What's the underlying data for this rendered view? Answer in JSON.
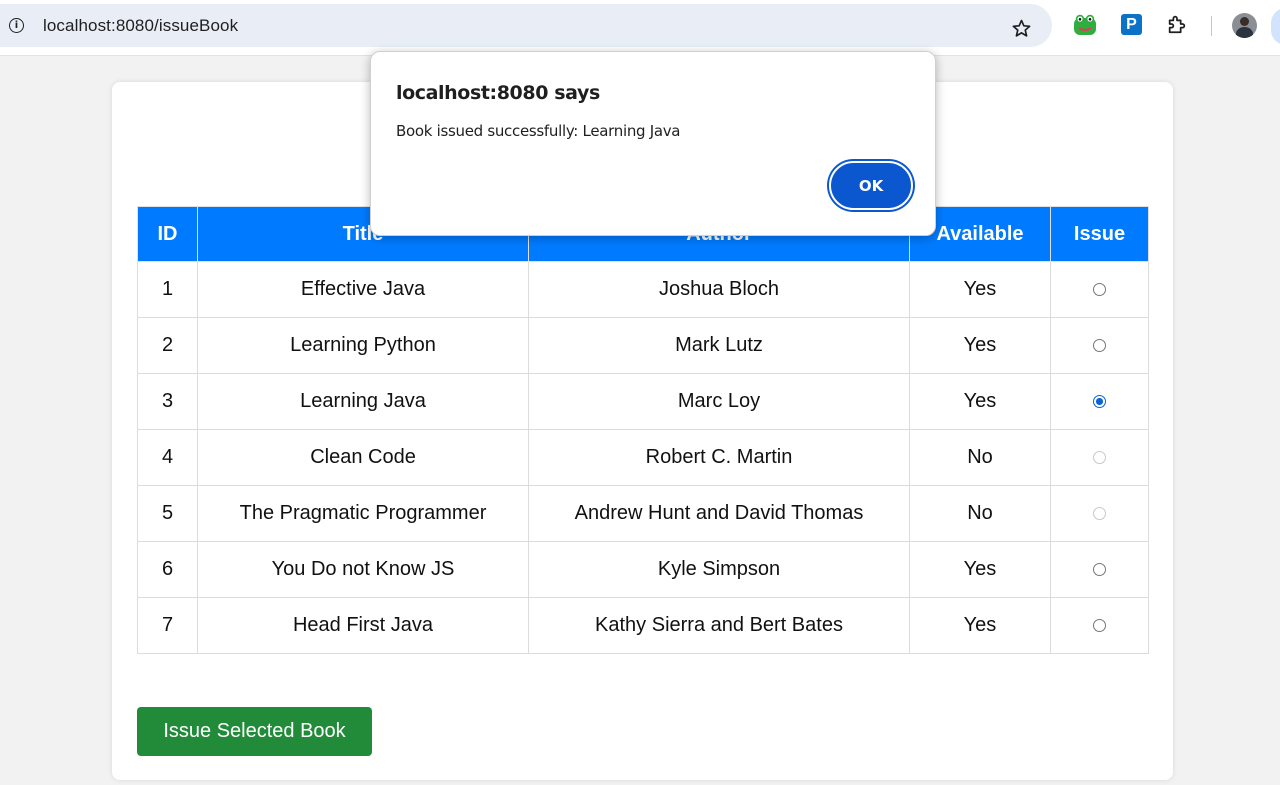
{
  "browser": {
    "url": "localhost:8080/issueBook",
    "extension_p_label": "P"
  },
  "table": {
    "headers": [
      "ID",
      "Title",
      "Author",
      "Available",
      "Issue"
    ],
    "rows": [
      {
        "id": "1",
        "title": "Effective Java",
        "author": "Joshua Bloch",
        "available": "Yes",
        "issue": "unchecked"
      },
      {
        "id": "2",
        "title": "Learning Python",
        "author": "Mark Lutz",
        "available": "Yes",
        "issue": "unchecked"
      },
      {
        "id": "3",
        "title": "Learning Java",
        "author": "Marc Loy",
        "available": "Yes",
        "issue": "checked"
      },
      {
        "id": "4",
        "title": "Clean Code",
        "author": "Robert C. Martin",
        "available": "No",
        "issue": "disabled"
      },
      {
        "id": "5",
        "title": "The Pragmatic Programmer",
        "author": "Andrew Hunt and David Thomas",
        "available": "No",
        "issue": "disabled"
      },
      {
        "id": "6",
        "title": "You Do not Know JS",
        "author": "Kyle Simpson",
        "available": "Yes",
        "issue": "unchecked"
      },
      {
        "id": "7",
        "title": "Head First Java",
        "author": "Kathy Sierra and Bert Bates",
        "available": "Yes",
        "issue": "unchecked"
      }
    ]
  },
  "issue_button_label": "Issue Selected Book",
  "dialog": {
    "title": "localhost:8080 says",
    "message": "Book issued successfully: Learning Java",
    "ok_label": "OK"
  },
  "colors": {
    "header_blue": "#007bff",
    "issue_button_green": "#228b3a",
    "dialog_ok_blue": "#0b57d0"
  }
}
